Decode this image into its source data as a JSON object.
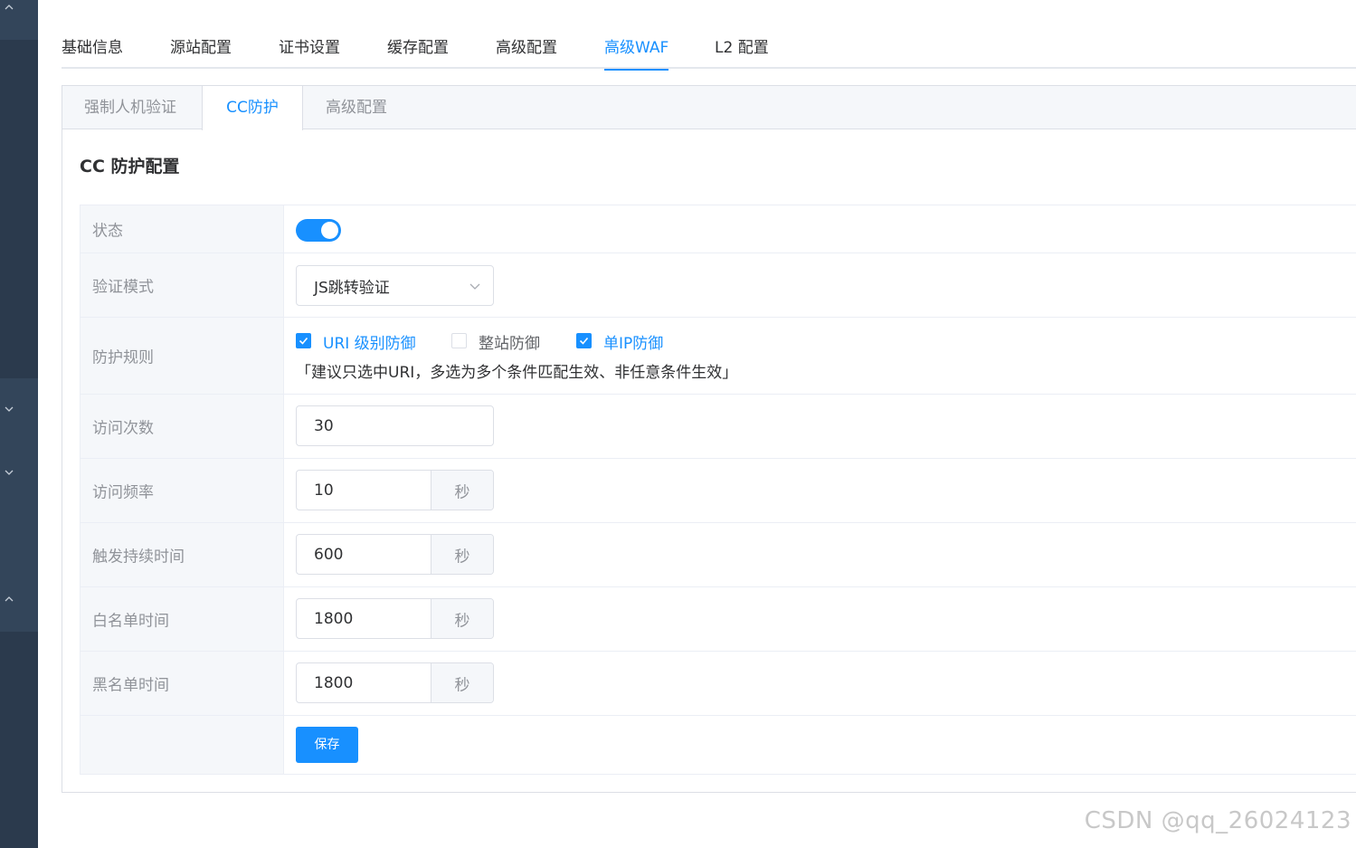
{
  "main_tabs": [
    {
      "label": "基础信息",
      "active": false
    },
    {
      "label": "源站配置",
      "active": false
    },
    {
      "label": "证书设置",
      "active": false
    },
    {
      "label": "缓存配置",
      "active": false
    },
    {
      "label": "高级配置",
      "active": false
    },
    {
      "label": "高级WAF",
      "active": true
    },
    {
      "label": "L2 配置",
      "active": false
    }
  ],
  "sub_tabs": [
    {
      "label": "强制人机验证",
      "active": false
    },
    {
      "label": "CC防护",
      "active": true
    },
    {
      "label": "高级配置",
      "active": false
    }
  ],
  "section_title": "CC 防护配置",
  "form": {
    "status": {
      "label": "状态",
      "enabled": true
    },
    "verify_mode": {
      "label": "验证模式",
      "value": "JS跳转验证"
    },
    "rules": {
      "label": "防护规则",
      "options": [
        {
          "label": "URI 级别防御",
          "checked": true
        },
        {
          "label": "整站防御",
          "checked": false
        },
        {
          "label": "单IP防御",
          "checked": true
        }
      ],
      "hint": "「建议只选中URI，多选为多个条件匹配生效、非任意条件生效」"
    },
    "visit_count": {
      "label": "访问次数",
      "value": "30"
    },
    "visit_rate": {
      "label": "访问频率",
      "value": "10",
      "unit": "秒"
    },
    "trigger_duration": {
      "label": "触发持续时间",
      "value": "600",
      "unit": "秒"
    },
    "whitelist_time": {
      "label": "白名单时间",
      "value": "1800",
      "unit": "秒"
    },
    "blacklist_time": {
      "label": "黑名单时间",
      "value": "1800",
      "unit": "秒"
    },
    "save_label": "保存"
  },
  "watermark": "CSDN @qq_26024123",
  "colors": {
    "accent": "#1890ff",
    "sidebar": "#2b3a4d"
  },
  "icons": {
    "select_arrow": "chevron-down-icon",
    "checkbox_mark": "check-icon"
  }
}
